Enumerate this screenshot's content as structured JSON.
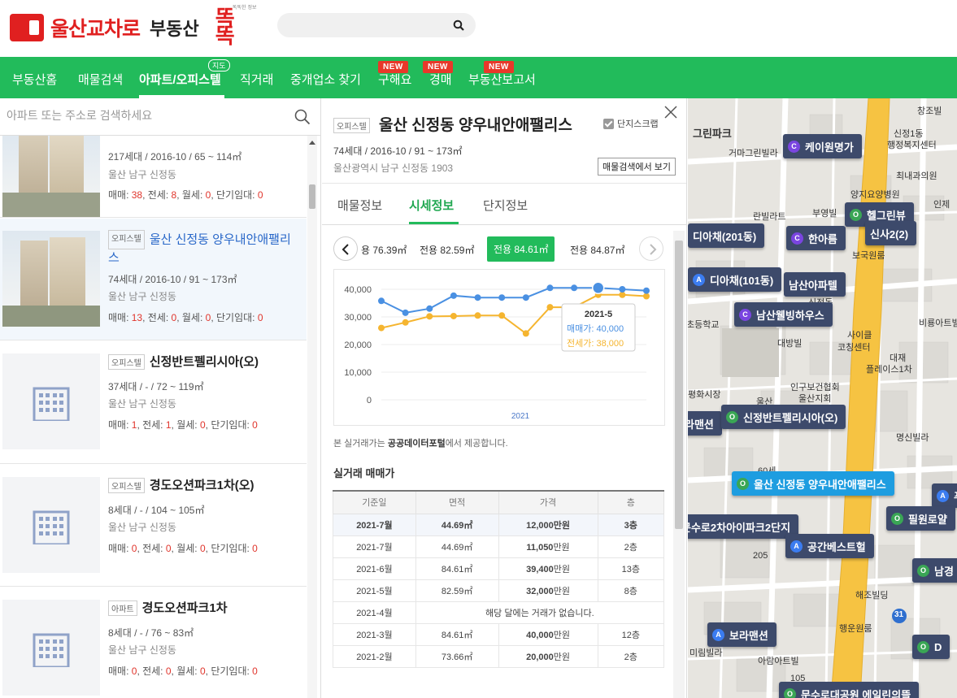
{
  "header": {
    "logo_main": "울산교차로",
    "logo_sub": "부동산",
    "logo_ddd": "똑똑",
    "logo_tiny": "똑똑한 정보"
  },
  "nav": {
    "items": [
      {
        "label": "부동산홈"
      },
      {
        "label": "매물검색"
      },
      {
        "label": "아파트/오피스텔"
      },
      {
        "label": "직거래"
      },
      {
        "label": "중개업소 찾기"
      },
      {
        "label": "구해요"
      },
      {
        "label": "경매"
      },
      {
        "label": "부동산보고서"
      }
    ],
    "map_badge": "지도",
    "new_badge": "NEW"
  },
  "left": {
    "search_placeholder": "아파트 또는 주소로 검색하세요",
    "items": [
      {
        "type": "",
        "title": "",
        "meta": "217세대 / 2016-10 / 65 ~ 114㎡",
        "loc": "울산 남구 신정동",
        "trade": {
          "l1": "매매: ",
          "v1": "38",
          "l2": ", 전세: ",
          "v2": "8",
          "l3": ", 월세: ",
          "v3": "0",
          "l4": ", 단기임대: ",
          "v4": "0"
        }
      },
      {
        "type": "오피스텔",
        "title": "울산 신정동 양우내안애팰리스",
        "meta": "74세대 / 2016-10 / 91 ~ 173㎡",
        "loc": "울산 남구 신정동",
        "trade": {
          "l1": "매매: ",
          "v1": "13",
          "l2": ", 전세: ",
          "v2": "0",
          "l3": ", 월세: ",
          "v3": "0",
          "l4": ", 단기임대: ",
          "v4": "0"
        }
      },
      {
        "type": "오피스텔",
        "title": "신정반트펠리시아(오)",
        "meta": "37세대 / - / 72 ~ 119㎡",
        "loc": "울산 남구 신정동",
        "trade": {
          "l1": "매매: ",
          "v1": "1",
          "l2": ", 전세: ",
          "v2": "1",
          "l3": ", 월세: ",
          "v3": "0",
          "l4": ", 단기임대: ",
          "v4": "0"
        }
      },
      {
        "type": "오피스텔",
        "title": "경도오션파크1차(오)",
        "meta": "8세대 / - / 104 ~ 105㎡",
        "loc": "울산 남구 신정동",
        "trade": {
          "l1": "매매: ",
          "v1": "0",
          "l2": ", 전세: ",
          "v2": "0",
          "l3": ", 월세: ",
          "v3": "0",
          "l4": ", 단기임대: ",
          "v4": "0"
        }
      },
      {
        "type": "아파트",
        "title": "경도오션파크1차",
        "meta": "8세대 / - / 76 ~ 83㎡",
        "loc": "울산 남구 신정동",
        "trade": {
          "l1": "매매: ",
          "v1": "0",
          "l2": ", 전세: ",
          "v2": "0",
          "l3": ", 월세: ",
          "v3": "0",
          "l4": ", 단기임대: ",
          "v4": "0"
        }
      }
    ]
  },
  "detail": {
    "type": "오피스텔",
    "title": "울산 신정동 양우내안애팰리스",
    "scrap_label": "단지스크랩",
    "meta": "74세대 / 2016-10 / 91 ~ 173㎡",
    "address": "울산광역시 남구 신정동 1903",
    "search_btn": "매물검색에서 보기",
    "tabs": [
      "매물정보",
      "시세정보",
      "단지정보"
    ],
    "areas": [
      "용 76.39㎡",
      "전용 82.59㎡",
      "전용 84.61㎡",
      "전용 84.87㎡"
    ],
    "source_pre": "본 실거래가는 ",
    "source_bold": "공공데이터포털",
    "source_post": "에서 제공합니다.",
    "section_title": "실거래 매매가",
    "table_headers": [
      "기준일",
      "면적",
      "가격",
      "층"
    ],
    "rows": [
      {
        "date": "2021-7월",
        "area": "44.69㎡",
        "price": "12,000",
        "unit": "만원",
        "floor": "3층"
      },
      {
        "date": "2021-7월",
        "area": "44.69㎡",
        "price": "11,050",
        "unit": "만원",
        "floor": "2층"
      },
      {
        "date": "2021-6월",
        "area": "84.61㎡",
        "price": "39,400",
        "unit": "만원",
        "floor": "13층"
      },
      {
        "date": "2021-5월",
        "area": "82.59㎡",
        "price": "32,000",
        "unit": "만원",
        "floor": "8층"
      },
      {
        "date": "2021-4월",
        "area": "",
        "price": "",
        "unit": "",
        "floor": "",
        "note": "해당 달에는 거래가 없습니다."
      },
      {
        "date": "2021-3월",
        "area": "84.61㎡",
        "price": "40,000",
        "unit": "만원",
        "floor": "12층"
      },
      {
        "date": "2021-2월",
        "area": "73.66㎡",
        "price": "20,000",
        "unit": "만원",
        "floor": "2층"
      }
    ]
  },
  "chart_data": {
    "type": "line",
    "x": [
      1,
      2,
      3,
      4,
      5,
      6,
      7,
      8,
      9,
      10,
      11,
      12
    ],
    "xlabel": "2021",
    "yticks": [
      "40,000",
      "30,000",
      "20,000",
      "10,000",
      "0"
    ],
    "ylim": [
      0,
      40000
    ],
    "series": [
      {
        "name": "매매가",
        "color": "#4a90e2",
        "values": [
          35800,
          31500,
          33000,
          37700,
          37000,
          37000,
          37000,
          40500,
          40500,
          40500,
          40000,
          39500
        ]
      },
      {
        "name": "전세가",
        "color": "#f5b530",
        "values": [
          26000,
          28000,
          30200,
          30300,
          30500,
          30500,
          24000,
          33500,
          33500,
          38000,
          38000,
          37500
        ]
      }
    ],
    "tooltip": {
      "title": "2021-5",
      "line1": "매매가: 40,000",
      "line2": "전세가: 38,000"
    },
    "grid": true
  },
  "map": {
    "labels": [
      "창조빌",
      "그린파크",
      "거마그린빌라",
      "신정1동",
      "행정복지센터",
      "최내과의원",
      "양지요양병원",
      "인제",
      "란빌라트",
      "부영빌",
      "보국원룸",
      "신정동",
      "비룡아트빌",
      "사이클",
      "코칭센터",
      "대방빌",
      "초등학교",
      "대재",
      "플레이스1차",
      "인구보건협회",
      "울산지회",
      "평화시장",
      "울산",
      "명신빌라",
      "60세",
      "205",
      "해조빌딩",
      "행운원룸",
      "미림빌라",
      "아람아트빌",
      "105"
    ],
    "markers": [
      {
        "kind": "C",
        "label": "케이원명가"
      },
      {
        "kind": "O",
        "label": "헬그린뷰"
      },
      {
        "kind": "",
        "label": "디아채(201동)"
      },
      {
        "kind": "C",
        "label": "한아름"
      },
      {
        "kind": "",
        "label": "신사2(2)"
      },
      {
        "kind": "A",
        "label": "디아채(101동)"
      },
      {
        "kind": "",
        "label": "남산아파텔"
      },
      {
        "kind": "C",
        "label": "남산웰빙하우스"
      },
      {
        "kind": "",
        "label": "라맨션"
      },
      {
        "kind": "O",
        "label": "신정반트펠리시아(오)"
      },
      {
        "kind": "O",
        "label": "울산 신정동 양우내안애팰리스"
      },
      {
        "kind": "A",
        "label": "푸"
      },
      {
        "kind": "",
        "label": "문수로2차아이파크2단지"
      },
      {
        "kind": "O",
        "label": "필원로얄"
      },
      {
        "kind": "A",
        "label": "공간베스트헐"
      },
      {
        "kind": "O",
        "label": "남경"
      },
      {
        "kind": "A",
        "label": "보라맨션"
      },
      {
        "kind": "O",
        "label": "D"
      },
      {
        "kind": "O",
        "label": "문수로대공원 에일린의뜰"
      }
    ],
    "road_number": "31"
  }
}
